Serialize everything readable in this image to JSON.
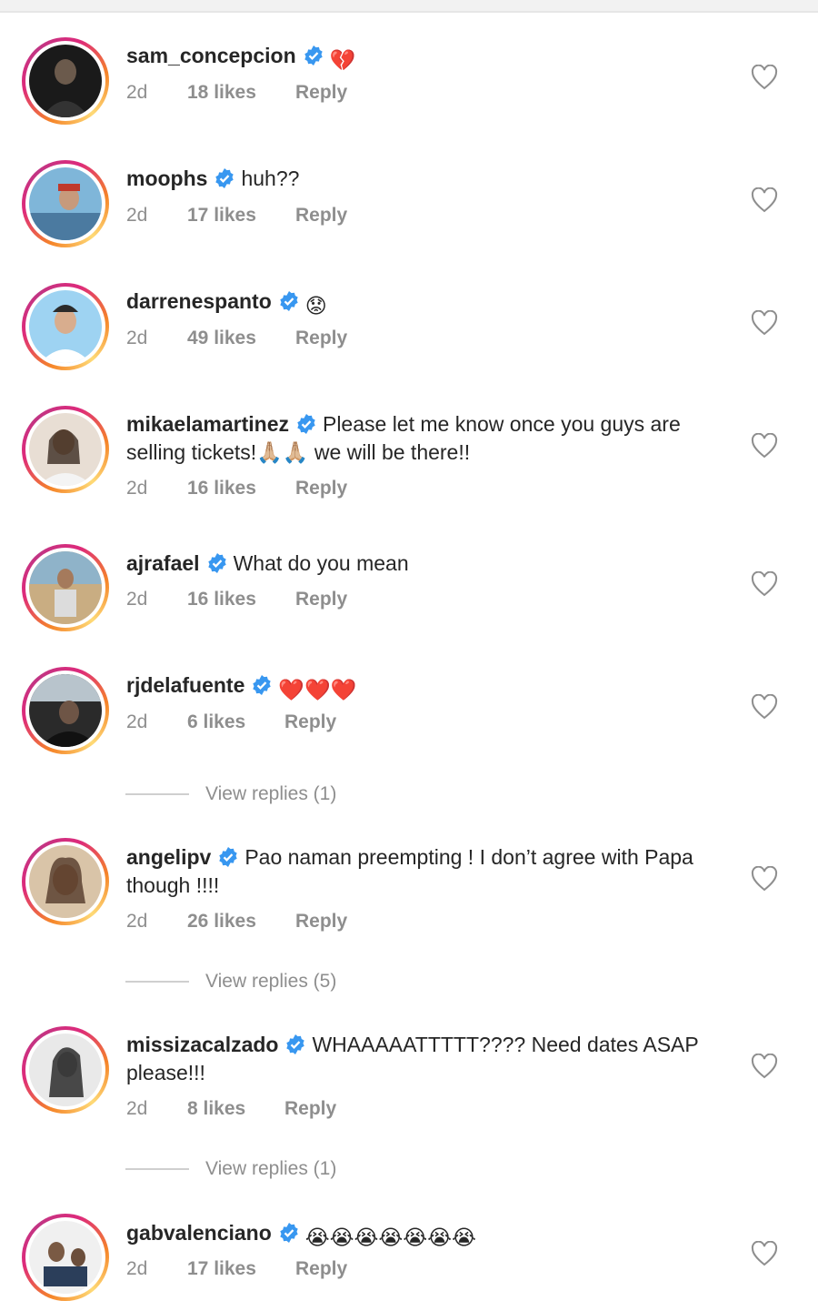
{
  "comments": [
    {
      "username": "sam_concepcion",
      "text": "",
      "emoji": "💔",
      "time": "2d",
      "likes": "18 likes",
      "reply": "Reply"
    },
    {
      "username": "moophs",
      "text": "huh??",
      "emoji": "",
      "time": "2d",
      "likes": "17 likes",
      "reply": "Reply"
    },
    {
      "username": "darrenespanto",
      "text": "",
      "emoji": "😟",
      "time": "2d",
      "likes": "49 likes",
      "reply": "Reply"
    },
    {
      "username": "mikaelamartinez",
      "text": "Please let me know once you guys are selling tickets!🙏🏼🙏🏼 we will be there!!",
      "emoji": "",
      "time": "2d",
      "likes": "16 likes",
      "reply": "Reply"
    },
    {
      "username": "ajrafael",
      "text": "What do you mean",
      "emoji": "",
      "time": "2d",
      "likes": "16 likes",
      "reply": "Reply"
    },
    {
      "username": "rjdelafuente",
      "text": "",
      "emoji": "❤️❤️❤️",
      "time": "2d",
      "likes": "6 likes",
      "reply": "Reply",
      "view_replies": "View replies (1)"
    },
    {
      "username": "angelipv",
      "text": "Pao naman preempting ! I don’t agree with Papa though !!!!",
      "emoji": "",
      "time": "2d",
      "likes": "26 likes",
      "reply": "Reply",
      "view_replies": "View replies (5)"
    },
    {
      "username": "missizacalzado",
      "text": "WHAAAAATTTTT???? Need dates ASAP please!!!",
      "emoji": "",
      "time": "2d",
      "likes": "8 likes",
      "reply": "Reply",
      "view_replies": "View replies (1)"
    },
    {
      "username": "gabvalenciano",
      "text": "",
      "emoji": "😭😭😭😭😭😭😭",
      "time": "2d",
      "likes": "17 likes",
      "reply": "Reply"
    }
  ],
  "icons": {
    "verified": "verified-badge-icon",
    "like": "heart-outline-icon"
  },
  "colors": {
    "verified": "#3897f0",
    "meta": "#8e8e8e",
    "text": "#262626",
    "ring_start": "#f58529",
    "ring_end": "#dd2a7b"
  }
}
